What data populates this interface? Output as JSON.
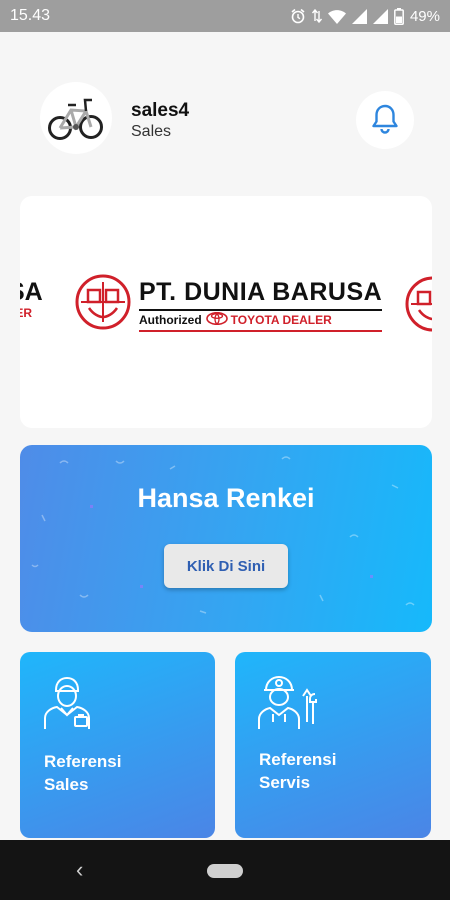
{
  "status_bar": {
    "time": "15.43",
    "battery": "49%",
    "icons": [
      "alarm-icon",
      "data-arrows-icon",
      "wifi-icon",
      "signal-icon",
      "signal-icon",
      "battery-icon"
    ]
  },
  "header": {
    "avatar_icon": "bicycle-icon",
    "user_name": "sales4",
    "user_role": "Sales",
    "notification_icon": "bell-icon"
  },
  "banner": {
    "company": "PT. DUNIA BARUSA",
    "authorized": "Authorized",
    "dealer": "TOYOTA DEALER",
    "fragment_top": "SA",
    "fragment_bottom": "LER",
    "brand_color": "#d0202a"
  },
  "promo": {
    "title": "Hansa Renkei",
    "button_label": "Klik Di Sini"
  },
  "cards": [
    {
      "label": "Referensi Sales",
      "icon": "salesperson-icon"
    },
    {
      "label": "Referensi Servis",
      "icon": "mechanic-icon"
    }
  ],
  "nav_bar": {
    "back_glyph": "‹",
    "icons": [
      "back-icon",
      "home-pill-icon"
    ]
  },
  "colors": {
    "accent": "#3a98ee",
    "card_gradient_start": "#1fb6fb",
    "card_gradient_end": "#4b85e6",
    "bell": "#2e86de"
  }
}
